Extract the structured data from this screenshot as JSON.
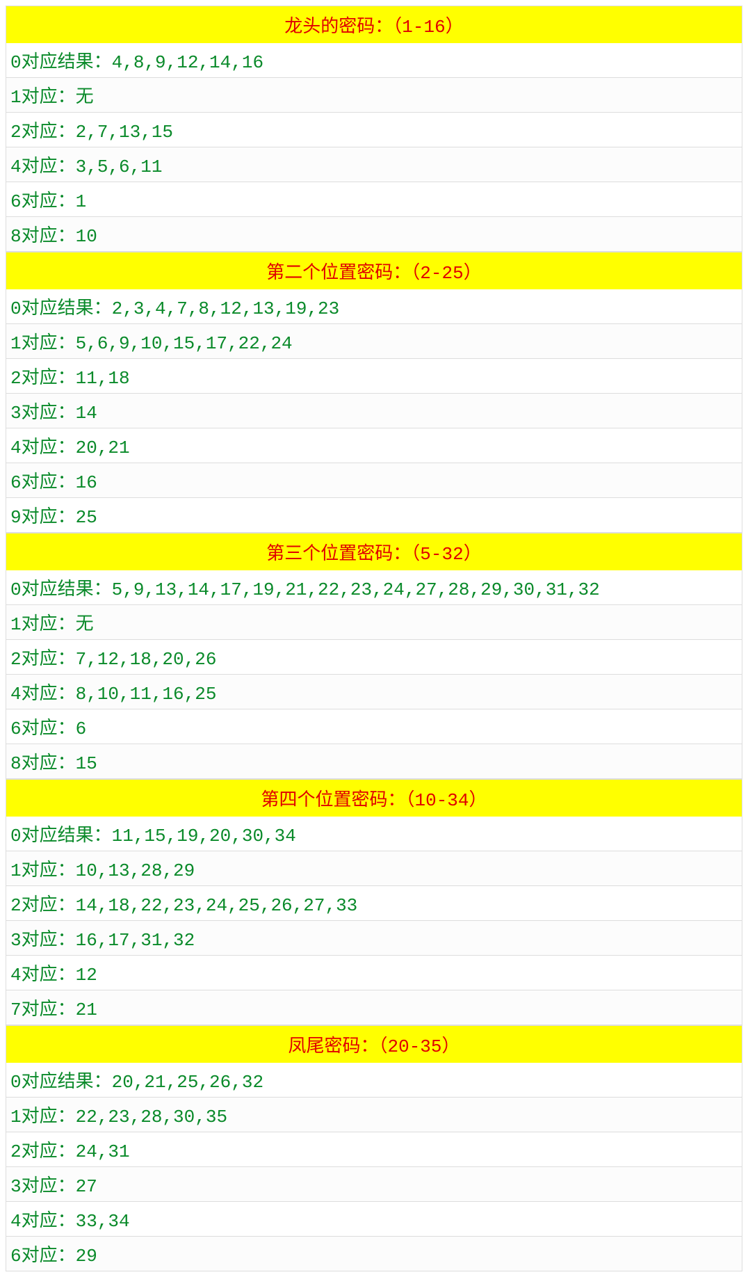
{
  "sections": [
    {
      "title": "龙头的密码：（1-16）",
      "rows": [
        {
          "label": "0对应结果：",
          "value": "4,8,9,12,14,16"
        },
        {
          "label": "1对应：",
          "value": "无"
        },
        {
          "label": "2对应：",
          "value": "2,7,13,15"
        },
        {
          "label": "4对应：",
          "value": "3,5,6,11"
        },
        {
          "label": "6对应：",
          "value": "1"
        },
        {
          "label": "8对应：",
          "value": "10"
        }
      ]
    },
    {
      "title": "第二个位置密码：（2-25）",
      "rows": [
        {
          "label": "0对应结果：",
          "value": "2,3,4,7,8,12,13,19,23"
        },
        {
          "label": "1对应：",
          "value": "5,6,9,10,15,17,22,24"
        },
        {
          "label": "2对应：",
          "value": "11,18"
        },
        {
          "label": "3对应：",
          "value": "14"
        },
        {
          "label": "4对应：",
          "value": "20,21"
        },
        {
          "label": "6对应：",
          "value": "16"
        },
        {
          "label": "9对应：",
          "value": "25"
        }
      ]
    },
    {
      "title": "第三个位置密码：（5-32）",
      "rows": [
        {
          "label": "0对应结果：",
          "value": "5,9,13,14,17,19,21,22,23,24,27,28,29,30,31,32"
        },
        {
          "label": "1对应：",
          "value": "无"
        },
        {
          "label": "2对应：",
          "value": "7,12,18,20,26"
        },
        {
          "label": "4对应：",
          "value": "8,10,11,16,25"
        },
        {
          "label": "6对应：",
          "value": "6"
        },
        {
          "label": "8对应：",
          "value": "15"
        }
      ]
    },
    {
      "title": "第四个位置密码：（10-34）",
      "rows": [
        {
          "label": "0对应结果：",
          "value": "11,15,19,20,30,34"
        },
        {
          "label": "1对应：",
          "value": "10,13,28,29"
        },
        {
          "label": "2对应：",
          "value": "14,18,22,23,24,25,26,27,33"
        },
        {
          "label": "3对应：",
          "value": "16,17,31,32"
        },
        {
          "label": "4对应：",
          "value": "12"
        },
        {
          "label": "7对应：",
          "value": "21"
        }
      ]
    },
    {
      "title": "凤尾密码：（20-35）",
      "rows": [
        {
          "label": "0对应结果：",
          "value": "20,21,25,26,32"
        },
        {
          "label": "1对应：",
          "value": "22,23,28,30,35"
        },
        {
          "label": "2对应：",
          "value": "24,31"
        },
        {
          "label": "3对应：",
          "value": "27"
        },
        {
          "label": "4对应：",
          "value": "33,34"
        },
        {
          "label": "6对应：",
          "value": "29"
        }
      ]
    }
  ]
}
